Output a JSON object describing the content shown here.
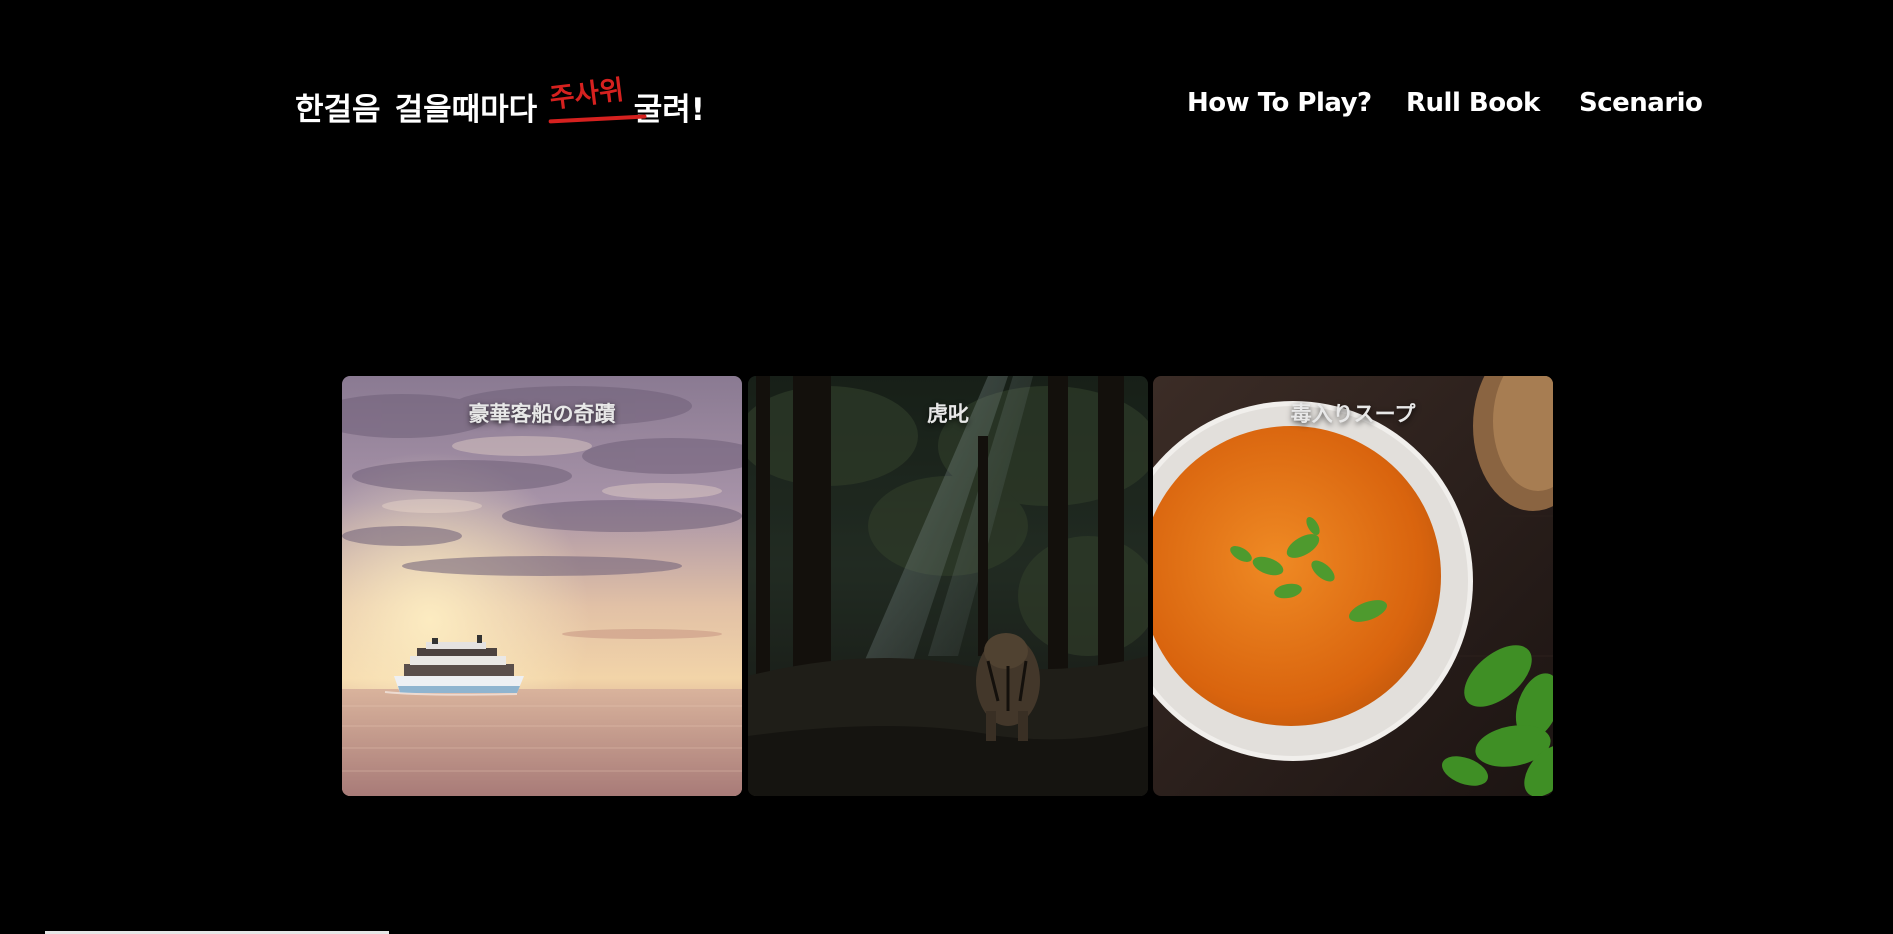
{
  "header": {
    "logo": {
      "part1": "한걸음",
      "part2": "걸을때마다",
      "highlight": "주사위",
      "part3": "굴려!",
      "highlight_color": "#d6211f"
    },
    "nav": [
      {
        "label": "How To Play?"
      },
      {
        "label": "Rull Book"
      },
      {
        "label": "Scenario"
      }
    ]
  },
  "scenarios": [
    {
      "title": "豪華客船の奇蹟",
      "image": "cruise-ship-sunset-image"
    },
    {
      "title": "虎叱",
      "image": "tiger-forest-image"
    },
    {
      "title": "毒入りスープ",
      "image": "tomato-soup-bowl-image"
    }
  ],
  "colors": {
    "background": "#000000",
    "text": "#ffffff",
    "accent": "#d6211f"
  }
}
